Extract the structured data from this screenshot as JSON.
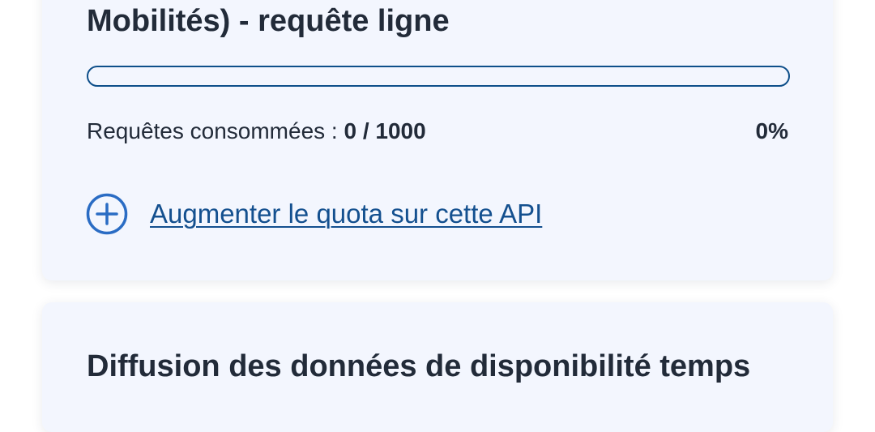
{
  "api_card": {
    "title": "Mobilités) - requête ligne",
    "usage_label": "Requêtes consommées : ",
    "usage_count": "0 / 1000",
    "usage_percent_text": "0%",
    "progress_fraction": 0,
    "quota_link_label": "Augmenter le quota sur cette API",
    "quota_icon": "plus-circle-icon"
  },
  "next_card": {
    "title": "Diffusion des données de disponibilité temps"
  },
  "colors": {
    "accent": "#0e4f8a",
    "link": "#14508f",
    "icon": "#2a6cc4",
    "card_background": "#f3f6fe",
    "text": "#222b39"
  }
}
